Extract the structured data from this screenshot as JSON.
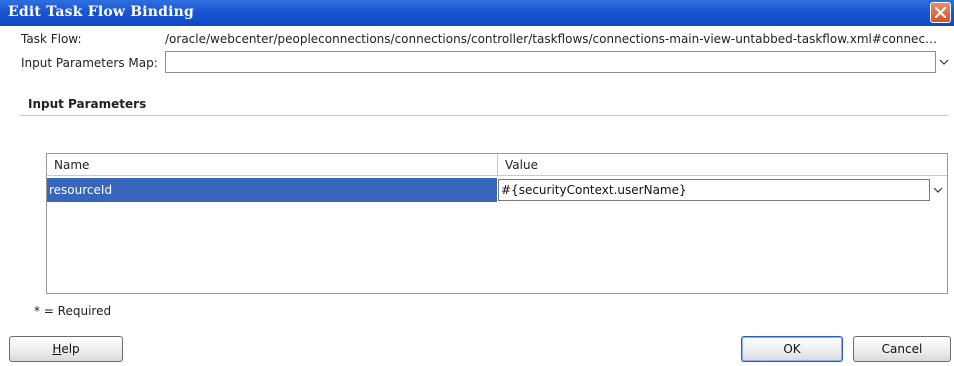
{
  "window": {
    "title": "Edit Task Flow Binding"
  },
  "form": {
    "task_flow_label": "Task Flow:",
    "task_flow_value": "/oracle/webcenter/peopleconnections/connections/controller/taskflows/connections-main-view-untabbed-taskflow.xml#connections-...",
    "input_params_map_label": "Input Parameters Map:",
    "input_params_map_value": ""
  },
  "section": {
    "title": "Input Parameters"
  },
  "table": {
    "columns": [
      "Name",
      "Value"
    ],
    "rows": [
      {
        "name": "resourceId",
        "value": "#{securityContext.userName}"
      }
    ]
  },
  "footer": {
    "required_note": "* = Required"
  },
  "buttons": {
    "help_first": "H",
    "help_rest": "elp",
    "ok": "OK",
    "cancel": "Cancel"
  },
  "icons": {
    "close": "close-icon",
    "dropdown": "chevron-down-icon"
  },
  "colors": {
    "titlebar": "#1a55d1",
    "selection": "#3866bd",
    "close_button": "#d5512c"
  }
}
